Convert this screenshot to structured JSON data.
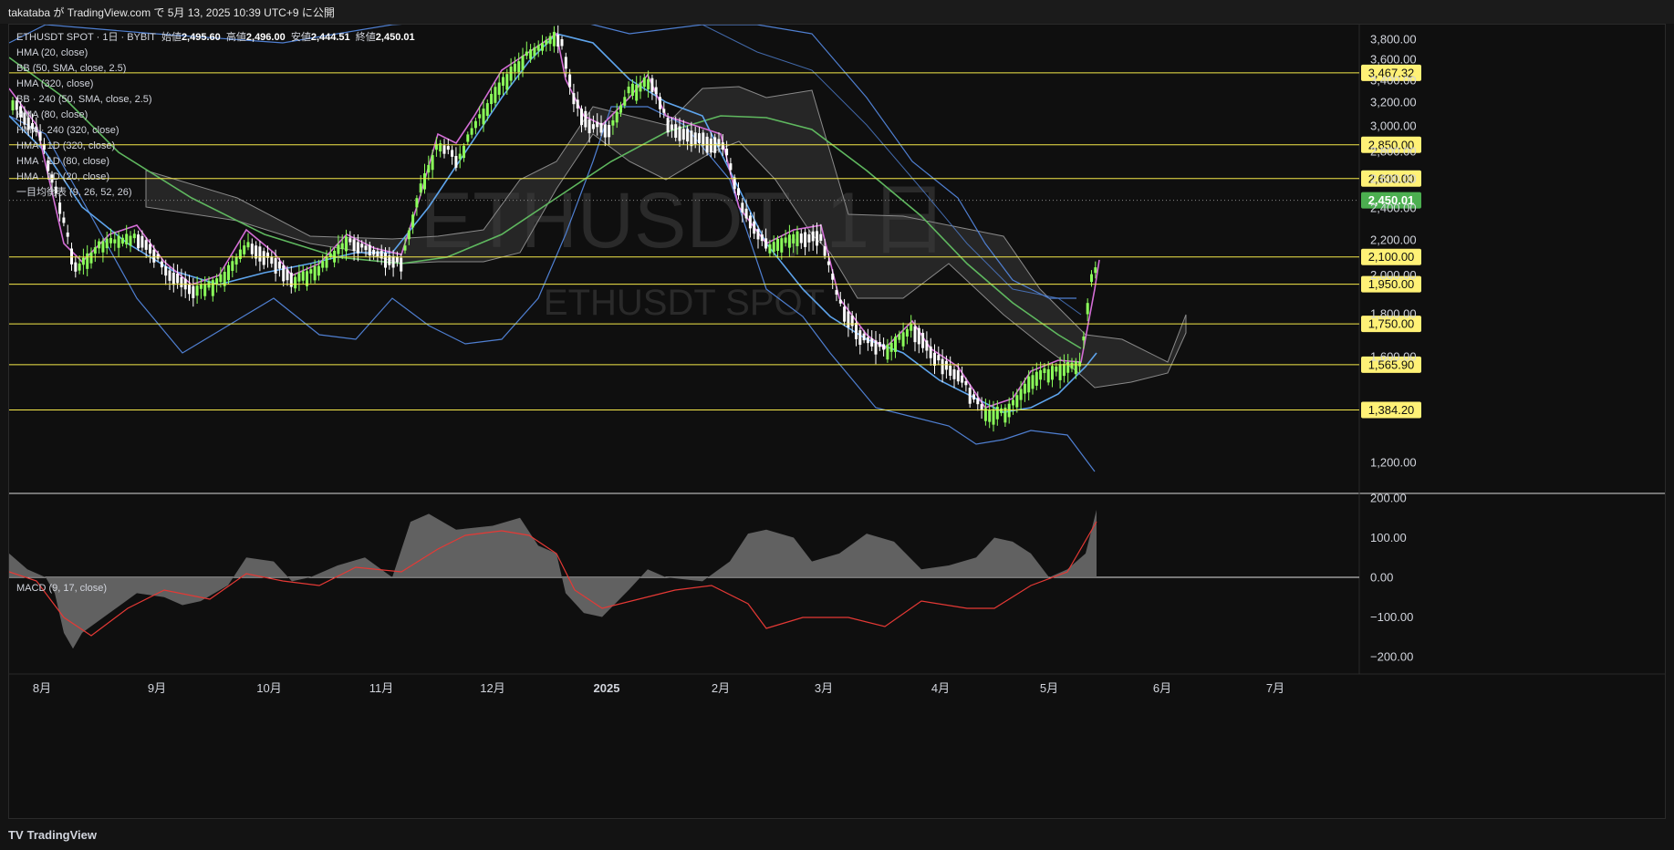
{
  "header": {
    "publisher_line": "takataba が TradingView.com で 5月 13, 2025 10:39 UTC+9 に公開"
  },
  "legend": {
    "symbol_line": "ETHUSDT SPOT · 1日 · BYBIT",
    "open_label": "始値",
    "open_value": "2,495.60",
    "high_label": "高値",
    "high_value": "2,496.00",
    "low_label": "安値",
    "low_value": "2,444.51",
    "close_label": "終値",
    "close_value": "2,450.01",
    "indicators": [
      "HMA (20, close)",
      "BB (50, SMA, close, 2.5)",
      "HMA (320, close)",
      "BB · 240 (50, SMA, close, 2.5)",
      "HMA (80, close)",
      "HMA · 240 (320, close)",
      "HMA · 1D (320, close)",
      "HMA · 1D (80, close)",
      "HMA · 1D (20, close)",
      "一目均衡表 (9, 26, 52, 26)"
    ],
    "macd_label": "MACD (9, 17, close)"
  },
  "watermark": {
    "big": "ETHUSDT, 1日",
    "small": "ETHUSDT SPOT"
  },
  "footer": {
    "logo_text": "TradingView",
    "logo_mark": "TV"
  },
  "colors": {
    "background": "#0f0f0f",
    "level_line": "#f5e94a",
    "level_label_bg": "#fff176",
    "last_price_bg": "#4caf50",
    "bb_band": "#4f7fd1",
    "hma20": "#d46ed6",
    "hma320": "#5fb85f",
    "hma80": "#5ea4ec",
    "cloud_fill": "#3a3a3a",
    "macd_hist": "#6a6a6a",
    "macd_signal": "#e53935",
    "candle_up": "#8bff5a",
    "candle_down": "#ffffff"
  },
  "chart_data": {
    "type": "candlestick",
    "symbol": "ETHUSDT SPOT",
    "timeframe": "1日",
    "exchange": "BYBIT",
    "y_axis": {
      "ticks": [
        "3,800.00",
        "3,600.00",
        "3,400.00",
        "3,200.00",
        "3,000.00",
        "2,800.00",
        "2,600.00",
        "2,400.00",
        "2,200.00",
        "2,000.00",
        "1,800.00",
        "1,600.00",
        "1,200.00"
      ],
      "scale": "log"
    },
    "x_axis": {
      "ticks": [
        "8月",
        "9月",
        "10月",
        "11月",
        "12月",
        "2025",
        "2月",
        "3月",
        "4月",
        "5月",
        "6月",
        "7月"
      ]
    },
    "horizontal_levels": [
      "3,467.32",
      "2,850.00",
      "2,600.00",
      "2,100.00",
      "1,950.00",
      "1,750.00",
      "1,565.90",
      "1,384.20"
    ],
    "last_price": "2,450.01",
    "macd": {
      "ticks": [
        "200.00",
        "100.00",
        "0.00",
        "−100.00",
        "−200.00"
      ]
    }
  }
}
